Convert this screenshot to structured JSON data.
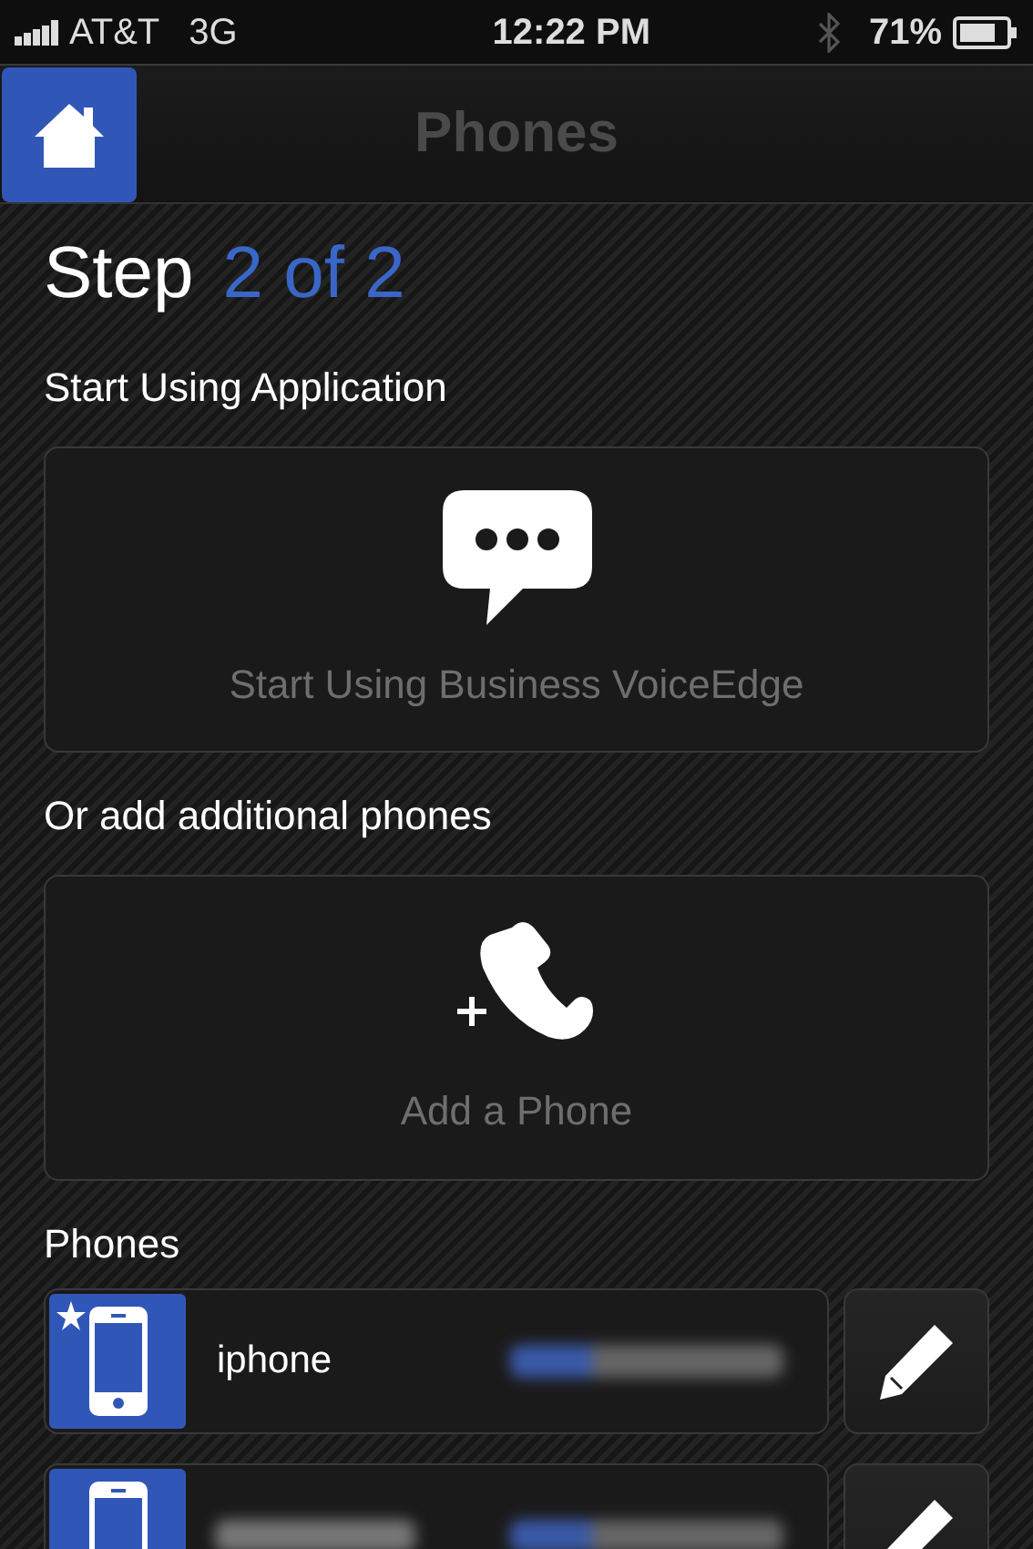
{
  "status_bar": {
    "carrier": "AT&T",
    "network": "3G",
    "time": "12:22 PM",
    "battery": "71%"
  },
  "nav": {
    "title": "Phones"
  },
  "step": {
    "label": "Step",
    "progress": "2 of 2"
  },
  "sections": [
    {
      "heading": "Start Using Application",
      "card": {
        "kind": "chat",
        "label": "Start Using Business VoiceEdge"
      }
    },
    {
      "heading": "Or add additional phones",
      "card": {
        "kind": "add-phone",
        "label": "Add a Phone"
      }
    }
  ],
  "phones_heading": "Phones",
  "phones": [
    {
      "name": "iphone",
      "primary": true
    },
    {
      "primary": false
    }
  ]
}
